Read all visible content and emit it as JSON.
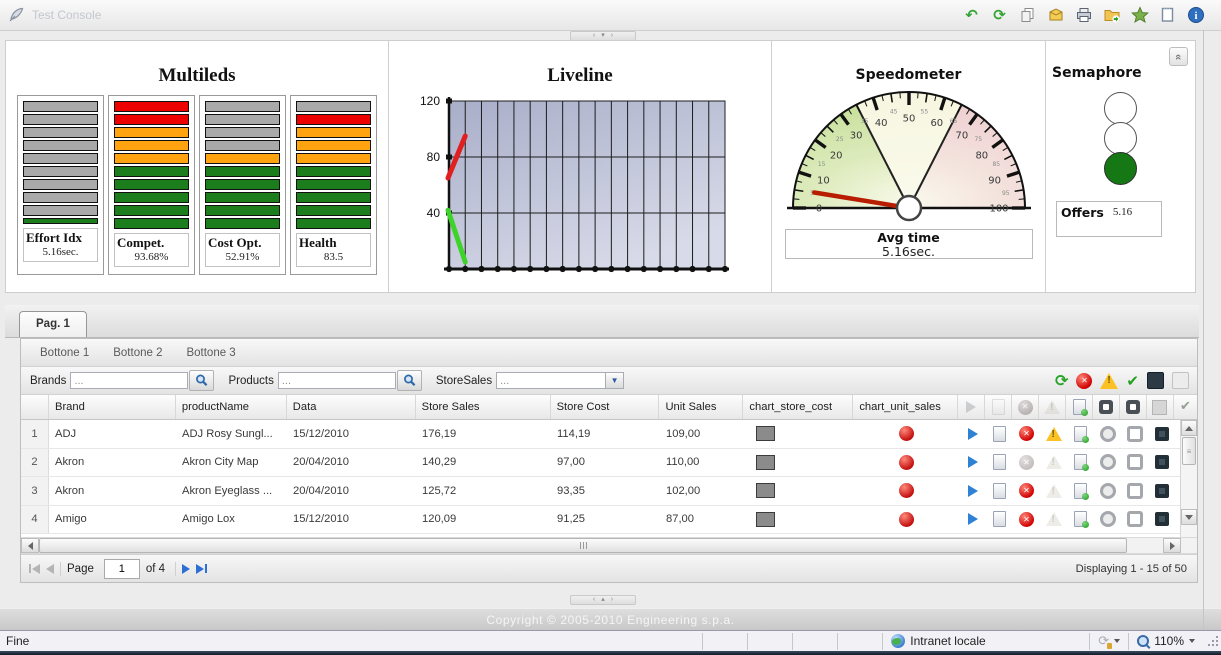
{
  "window": {
    "title": "Test Console",
    "titlebar_icons": [
      "undo-icon",
      "refresh-icon",
      "copy-icon",
      "package-icon",
      "print-icon",
      "folder-open-icon",
      "star-icon",
      "note-icon",
      "info-icon"
    ]
  },
  "dashboard": {
    "multileds": {
      "title": "Multileds",
      "colors": {
        "gray": "#a9a9a9",
        "green": "#1c7d1c",
        "red": "#ed0000",
        "orange": "#ffa410"
      },
      "leds": [
        {
          "label": "Effort Idx",
          "value": "5.16sec.",
          "segments": [
            "gray",
            "gray",
            "gray",
            "gray",
            "gray",
            "gray",
            "gray",
            "gray",
            "gray",
            "green-half"
          ]
        },
        {
          "label": "Compet.",
          "value": "93.68%",
          "segments": [
            "red",
            "red",
            "orange",
            "orange",
            "orange",
            "green",
            "green",
            "green",
            "green",
            "green"
          ]
        },
        {
          "label": "Cost Opt.",
          "value": "52.91%",
          "segments": [
            "gray",
            "gray",
            "gray",
            "gray",
            "orange",
            "green",
            "green",
            "green",
            "green",
            "green"
          ]
        },
        {
          "label": "Health",
          "value": "83.5",
          "segments": [
            "gray",
            "red",
            "orange",
            "orange",
            "orange",
            "green",
            "green",
            "green",
            "green",
            "green"
          ]
        }
      ]
    },
    "liveline": {
      "title": "Liveline",
      "type": "line",
      "ylim": [
        0,
        120
      ],
      "yticks": [
        40,
        80,
        120
      ],
      "x_gridlines": 17,
      "series": [
        {
          "name": "red-series",
          "color": "#e02020",
          "points": [
            65,
            95
          ]
        },
        {
          "name": "green-series",
          "color": "#3ed32a",
          "points": [
            42,
            5
          ]
        }
      ]
    },
    "speedometer": {
      "title": "Speedometer",
      "min": 0,
      "max": 100,
      "zones": [
        {
          "to": 35,
          "color": "#c9e09b"
        },
        {
          "to": 65,
          "color": "#f7f6e0"
        },
        {
          "to": 100,
          "color": "#eed0d0"
        }
      ],
      "value": 5.16,
      "caption": "Avg time",
      "caption_value": "5.16sec."
    },
    "semaphore": {
      "title": "Semaphore",
      "lights": [
        "off",
        "off",
        "green"
      ],
      "caption": "Offers",
      "caption_value": "5.16"
    }
  },
  "grid": {
    "tab": "Pag. 1",
    "buttons": [
      "Bottone 1",
      "Bottone 2",
      "Bottone 3"
    ],
    "filters": {
      "brands_label": "Brands",
      "brands_value": "...",
      "products_label": "Products",
      "products_value": "...",
      "storesales_label": "StoreSales",
      "storesales_value": "..."
    },
    "toolbar_icons": [
      "refresh-icon",
      "delete-icon",
      "warning-icon",
      "accept-icon",
      "dark-grid-icon",
      "light-grid-icon"
    ],
    "columns": [
      "",
      "Brand",
      "productName",
      "Data",
      "Store Sales",
      "Store Cost",
      "Unit Sales",
      "chart_store_cost",
      "chart_unit_sales"
    ],
    "row_action_icons": [
      "run",
      "document",
      "delete",
      "warning",
      "document-add",
      "ring",
      "rounded-square",
      "dark-square"
    ],
    "rows": [
      {
        "num": "1",
        "brand": "ADJ",
        "product": "ADJ Rosy Sungl...",
        "date": "15/12/2010",
        "store_sales": "176,19",
        "store_cost": "114,19",
        "unit_sales": "109,00",
        "delete_enabled": true,
        "warn_enabled": true
      },
      {
        "num": "2",
        "brand": "Akron",
        "product": "Akron City Map",
        "date": "20/04/2010",
        "store_sales": "140,29",
        "store_cost": "97,00",
        "unit_sales": "110,00",
        "delete_enabled": false,
        "warn_enabled": false
      },
      {
        "num": "3",
        "brand": "Akron",
        "product": "Akron Eyeglass ...",
        "date": "20/04/2010",
        "store_sales": "125,72",
        "store_cost": "93,35",
        "unit_sales": "102,00",
        "delete_enabled": true,
        "warn_enabled": false
      },
      {
        "num": "4",
        "brand": "Amigo",
        "product": "Amigo Lox",
        "date": "15/12/2010",
        "store_sales": "120,09",
        "store_cost": "91,25",
        "unit_sales": "87,00",
        "delete_enabled": true,
        "warn_enabled": false
      }
    ],
    "pager": {
      "page_label": "Page",
      "page_value": "1",
      "of_label": "of 4",
      "displaying": "Displaying 1 - 15 of 50"
    }
  },
  "footer": {
    "copyright": "Copyright © 2005-2010 Engineering s.p.a."
  },
  "statusbar": {
    "left": "Fine",
    "network_zone": "Intranet locale",
    "zoom": "110%"
  }
}
